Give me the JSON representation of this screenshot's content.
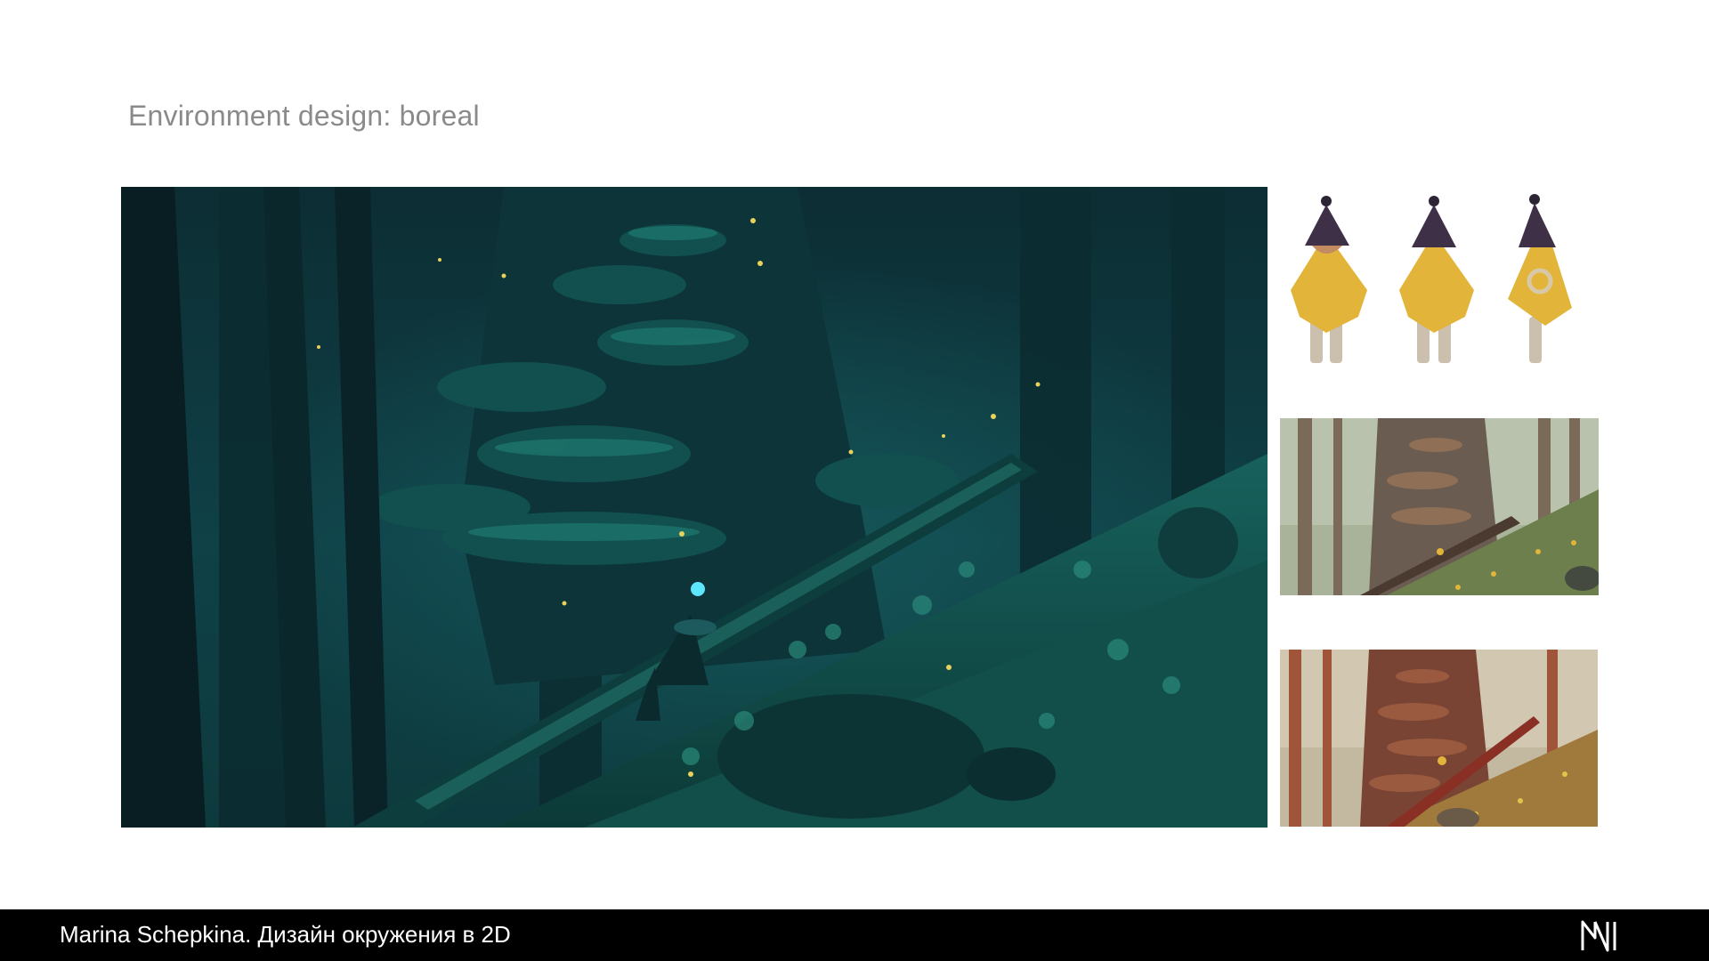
{
  "header": {
    "title": "Environment design: boreal"
  },
  "artwork": {
    "main_scene": "boreal forest night scene",
    "palette": {
      "night_teal": "#0f4a4c",
      "deep_shadow": "#07191b",
      "firefly": "#e8d25a",
      "lantern": "#5fe6ff",
      "cloak_yellow": "#e3b43a",
      "hat_purple": "#3e3047"
    }
  },
  "footer": {
    "credit": "Marina Schepkina. Дизайн окружения в 2D",
    "logo_icon": "mn-monogram-icon"
  }
}
